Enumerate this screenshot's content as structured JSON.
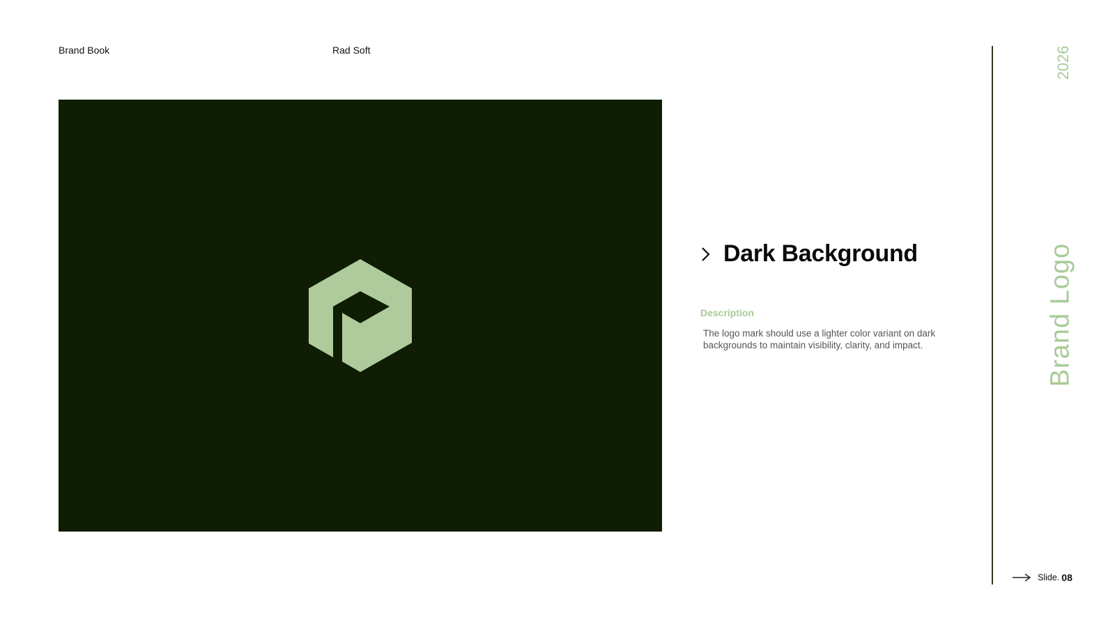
{
  "header": {
    "left_label": "Brand Book",
    "center_label": "Rad Soft"
  },
  "logo_panel": {
    "background_color": "#0e1d04",
    "mark_color": "#b0cb9b",
    "icon": "rad-soft-hexagon-logo-icon"
  },
  "content": {
    "title": "Dark Background",
    "description_label": "Description",
    "description": "The logo mark should use a lighter color variant on dark backgrounds to maintain visibility, clarity, and impact."
  },
  "sidebar": {
    "year": "2026",
    "vertical_title": "Brand Logo",
    "accent_color": "#a9cb98"
  },
  "footer": {
    "slide_label": "Slide.",
    "slide_number": "08"
  }
}
